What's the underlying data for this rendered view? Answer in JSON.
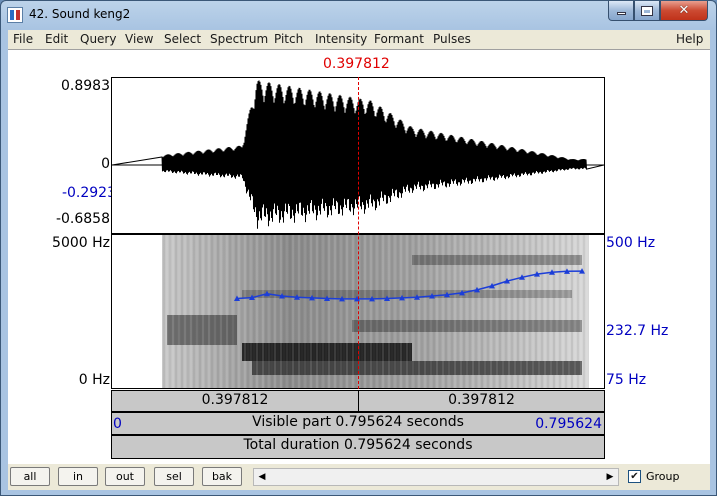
{
  "window": {
    "title": "42. Sound keng2",
    "controls": {
      "minimize_icon": "minimize-icon",
      "maximize_icon": "maximize-icon",
      "close_icon": "close-icon"
    }
  },
  "menu": {
    "items": [
      "File",
      "Edit",
      "Query",
      "View",
      "Select",
      "Spectrum",
      "Pitch",
      "Intensity",
      "Formant",
      "Pulses"
    ],
    "help": "Help"
  },
  "editor": {
    "cursor_time": "0.397812",
    "waveform": {
      "y_max": "0.8983",
      "y_zero": "0",
      "y_cursor": "-0.2923",
      "y_min": "-0.6858"
    },
    "spectrogram": {
      "freq_max": "5000 Hz",
      "freq_min": "0 Hz"
    },
    "pitch": {
      "max": "500 Hz",
      "cursor_value": "232.7 Hz",
      "min": "75 Hz",
      "contour_hz": [
        230,
        233,
        245,
        238,
        234,
        232,
        230,
        229,
        229,
        229,
        230,
        232,
        234,
        238,
        242,
        248,
        258,
        272,
        290,
        305,
        318,
        326,
        330,
        331
      ]
    },
    "selection": {
      "left_part": "0.397812",
      "right_part": "0.397812"
    },
    "visible": {
      "start": "0",
      "label": "Visible part 0.795624 seconds",
      "end": "0.795624"
    },
    "total": {
      "label": "Total duration 0.795624 seconds"
    },
    "colors": {
      "cursor": "#e00000",
      "pitch": "#1c3ed8",
      "axis_blue": "#0000c0"
    }
  },
  "bottom": {
    "buttons": {
      "all": "all",
      "in": "in",
      "out": "out",
      "sel": "sel",
      "bak": "bak"
    },
    "scroll_left_icon": "scroll-left-icon",
    "scroll_right_icon": "scroll-right-icon",
    "group": {
      "checked": true,
      "label": "Group"
    }
  }
}
